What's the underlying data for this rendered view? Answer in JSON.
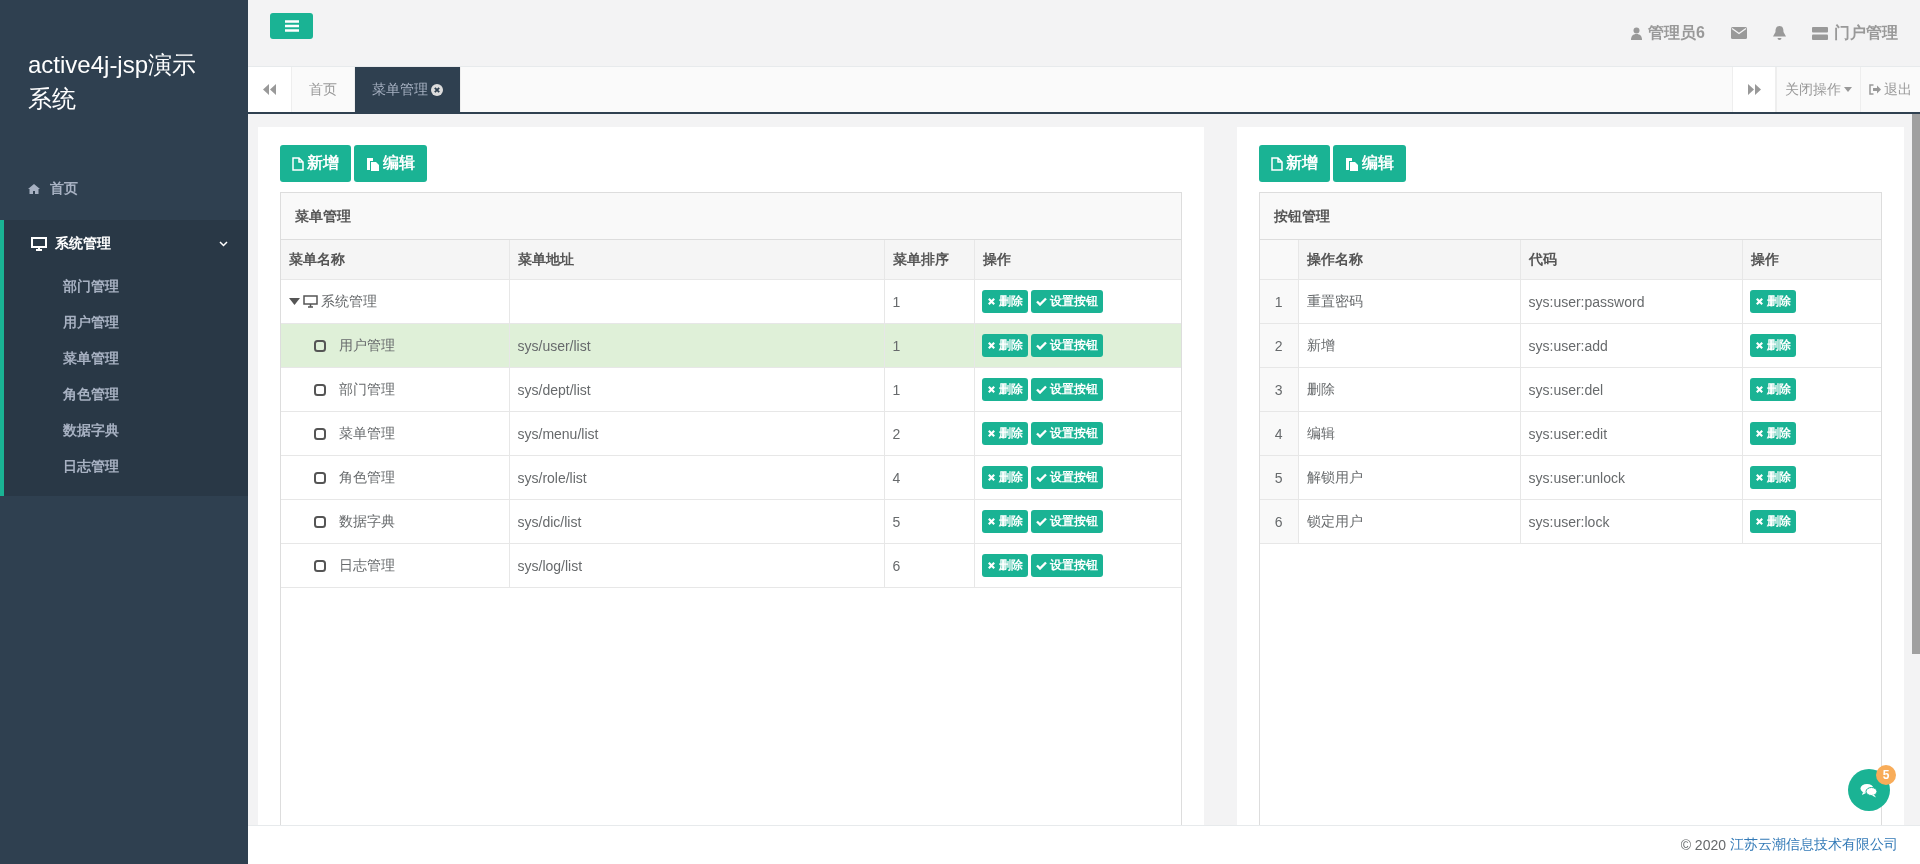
{
  "sidebar": {
    "title": "active4j-jsp演示系统",
    "items": [
      {
        "kind": "link",
        "label": "首页"
      },
      {
        "kind": "group",
        "label": "系统管理",
        "expanded": true,
        "children": [
          {
            "label": "部门管理"
          },
          {
            "label": "用户管理"
          },
          {
            "label": "菜单管理"
          },
          {
            "label": "角色管理"
          },
          {
            "label": "数据字典"
          },
          {
            "label": "日志管理"
          }
        ]
      }
    ]
  },
  "header": {
    "user": "管理员6",
    "portal": "门户管理"
  },
  "tabs": [
    {
      "label": "首页",
      "selected": false,
      "closable": false
    },
    {
      "label": "菜单管理",
      "selected": true,
      "closable": true
    }
  ],
  "tab_actions": {
    "close_menu": "关闭操作",
    "logout": "退出"
  },
  "menu_panel": {
    "toolbar": [
      "新增",
      "编辑"
    ],
    "title": "菜单管理",
    "columns": [
      "菜单名称",
      "菜单地址",
      "菜单排序",
      "操作"
    ],
    "rows": [
      {
        "name": "系统管理",
        "order": "1",
        "selected": false,
        "expanded": true,
        "actions": [
          "删除",
          "设置按钮"
        ],
        "children": [
          {
            "name": "用户管理",
            "url": "sys/user/list",
            "order": "1",
            "selected": true,
            "actions": [
              "删除",
              "设置按钮"
            ]
          },
          {
            "name": "部门管理",
            "url": "sys/dept/list",
            "order": "1",
            "selected": false,
            "actions": [
              "删除",
              "设置按钮"
            ]
          },
          {
            "name": "菜单管理",
            "url": "sys/menu/list",
            "order": "2",
            "selected": false,
            "actions": [
              "删除",
              "设置按钮"
            ]
          },
          {
            "name": "角色管理",
            "url": "sys/role/list",
            "order": "4",
            "selected": false,
            "actions": [
              "删除",
              "设置按钮"
            ]
          },
          {
            "name": "数据字典",
            "url": "sys/dic/list",
            "order": "5",
            "selected": false,
            "actions": [
              "删除",
              "设置按钮"
            ]
          },
          {
            "name": "日志管理",
            "url": "sys/log/list",
            "order": "6",
            "selected": false,
            "actions": [
              "删除",
              "设置按钮"
            ]
          }
        ]
      }
    ]
  },
  "button_panel": {
    "toolbar": [
      "新增",
      "编辑"
    ],
    "title": "按钮管理",
    "columns": [
      "操作名称",
      "代码",
      "操作"
    ],
    "rows": [
      {
        "index": "1",
        "name": "重置密码",
        "code": "sys:user:password",
        "action": "删除"
      },
      {
        "index": "2",
        "name": "新增",
        "code": "sys:user:add",
        "action": "删除"
      },
      {
        "index": "3",
        "name": "删除",
        "code": "sys:user:del",
        "action": "删除"
      },
      {
        "index": "4",
        "name": "编辑",
        "code": "sys:user:edit",
        "action": "删除"
      },
      {
        "index": "5",
        "name": "解锁用户",
        "code": "sys:user:unlock",
        "action": "删除"
      },
      {
        "index": "6",
        "name": "锁定用户",
        "code": "sys:user:lock",
        "action": "删除"
      }
    ]
  },
  "chat": {
    "badge": "5"
  },
  "footer": {
    "copyright": "© 2020",
    "company": "江苏云潮信息技术有限公司"
  }
}
